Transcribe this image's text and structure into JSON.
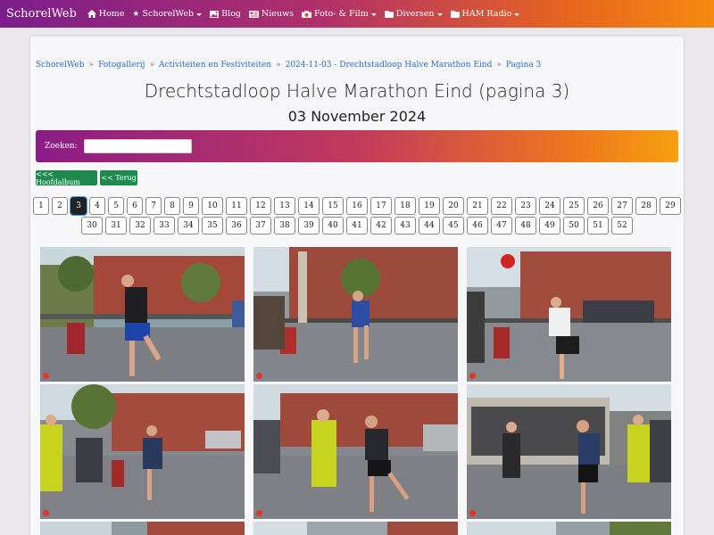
{
  "navbar": {
    "brand": "SchorelWeb",
    "items": [
      {
        "label": "Home",
        "icon": "home-icon",
        "dropdown": false
      },
      {
        "label": "SchorelWeb",
        "icon": "star-icon",
        "dropdown": true
      },
      {
        "label": "Blog",
        "icon": "image-icon",
        "dropdown": false
      },
      {
        "label": "Nieuws",
        "icon": "newspaper-icon",
        "dropdown": false
      },
      {
        "label": "Foto- & Film",
        "icon": "camera-icon",
        "dropdown": true
      },
      {
        "label": "Diversen",
        "icon": "folder-icon",
        "dropdown": true
      },
      {
        "label": "HAM Radio",
        "icon": "folder-icon",
        "dropdown": true
      }
    ]
  },
  "breadcrumb": [
    "SchorelWeb",
    "Fotogallerij",
    "Activiteiten en Festiviteiten",
    "2024-11-03 - Drechtstadloop Halve Marathon Eind",
    "Pagina 3"
  ],
  "breadcrumb_sep": "»",
  "title": "Drechtstadloop Halve Marathon Eind (pagina 3)",
  "subtitle": "03 November 2024",
  "search": {
    "label": "Zoeken:",
    "value": ""
  },
  "buttons": {
    "album": "<<< Hoofdalbum",
    "back": "<< Terug"
  },
  "pagination": {
    "current": 3,
    "rows": [
      [
        "1",
        "2",
        "3",
        "4",
        "5",
        "6",
        "7",
        "8",
        "9",
        "10",
        "11",
        "12",
        "13",
        "14",
        "15",
        "16",
        "17",
        "18",
        "19",
        "20",
        "21",
        "22",
        "23",
        "24",
        "25",
        "26",
        "27",
        "28",
        "29"
      ],
      [
        "30",
        "31",
        "32",
        "33",
        "34",
        "35",
        "36",
        "37",
        "38",
        "39",
        "40",
        "41",
        "42",
        "43",
        "44",
        "45",
        "46",
        "47",
        "48",
        "49",
        "50",
        "51",
        "52"
      ]
    ]
  },
  "colors": {
    "accent_green": "#1e8a4d",
    "nav_start": "#7c1d8c",
    "nav_end": "#f58a10"
  }
}
